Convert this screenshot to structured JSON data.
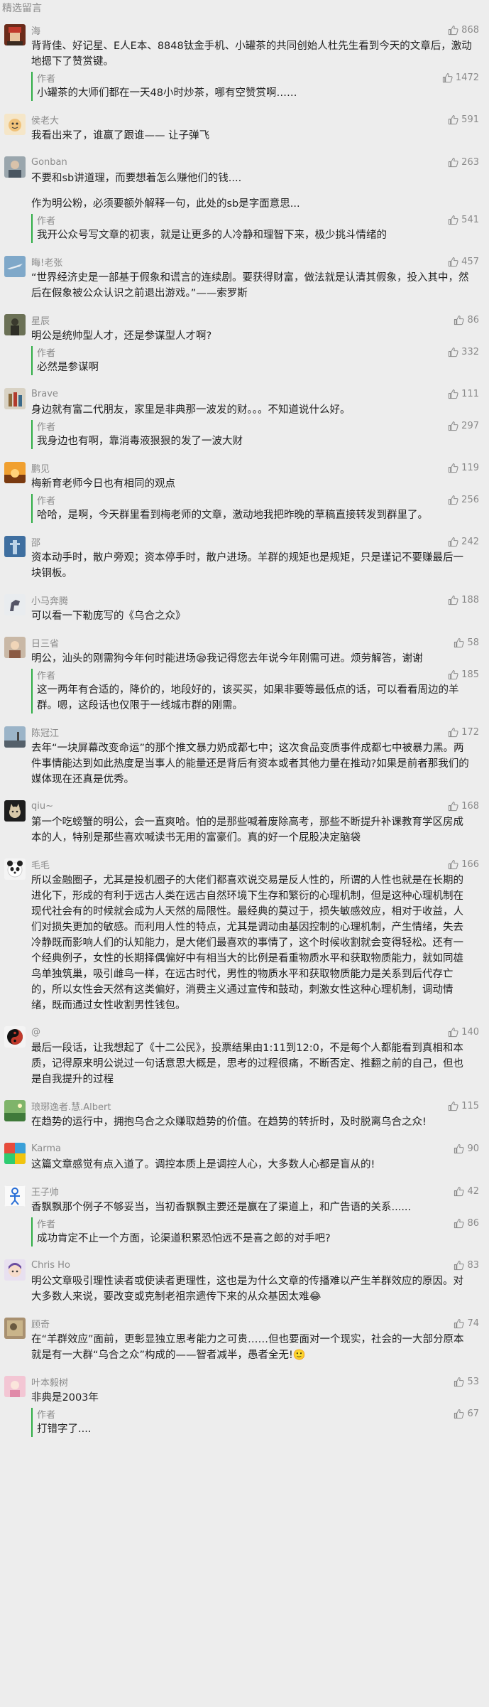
{
  "section_title": "精选留言",
  "colors": {
    "accent_green": "#2fae46",
    "meta_gray": "#8a8a8a",
    "background": "#ededed"
  },
  "comments": [
    {
      "nick": "海",
      "likes": "868",
      "avatar": "avatar-red-cap",
      "paras": [
        "背背佳、好记星、E人E本、8848钛金手机、小罐茶的共同创始人杜先生看到今天的文章后，激动地摁下了赞赏键。"
      ],
      "reply": {
        "label": "作者",
        "likes": "1472",
        "text": "小罐茶的大师们都在一天48小时炒茶，哪有空赞赏啊……"
      }
    },
    {
      "nick": "侯老大",
      "likes": "591",
      "avatar": "avatar-cartoon",
      "paras": [
        "我看出来了，谁赢了跟谁—— 让子弹飞"
      ],
      "reply": null
    },
    {
      "nick": "Gonban",
      "likes": "263",
      "avatar": "avatar-photo",
      "paras": [
        "不要和sb讲道理，而要想着怎么赚他们的钱....",
        "作为明公粉，必须要额外解释一句，此处的sb是字面意思..."
      ],
      "reply": {
        "label": "作者",
        "likes": "541",
        "text": "我开公众号写文章的初衷，就是让更多的人冷静和理智下来，极少挑斗情绪的"
      }
    },
    {
      "nick": "晦!老张",
      "likes": "457",
      "avatar": "avatar-blue-plane",
      "paras": [
        "“世界经济史是一部基于假象和谎言的连续剧。要获得财富，做法就是认清其假象，投入其中，然后在假象被公众认识之前退出游戏。”——索罗斯"
      ],
      "reply": null
    },
    {
      "nick": "星辰",
      "likes": "86",
      "avatar": "avatar-dark-figure",
      "paras": [
        "明公是统帅型人才，还是参谋型人才啊?"
      ],
      "reply": {
        "label": "作者",
        "likes": "332",
        "text": "必然是参谋啊"
      }
    },
    {
      "nick": "Brave",
      "likes": "111",
      "avatar": "avatar-bottles",
      "paras": [
        "身边就有富二代朋友，家里是非典那一波发的财。。。不知道说什么好。"
      ],
      "reply": {
        "label": "作者",
        "likes": "297",
        "text": "我身边也有啊，靠消毒液狠狠的发了一波大财"
      }
    },
    {
      "nick": "鹏见",
      "likes": "119",
      "avatar": "avatar-sunset",
      "paras": [
        "梅新育老师今日也有相同的观点"
      ],
      "reply": {
        "label": "作者",
        "likes": "256",
        "text": "哈哈，是啊，今天群里看到梅老师的文章，激动地我把昨晚的草稿直接转发到群里了。"
      }
    },
    {
      "nick": "邵",
      "likes": "242",
      "avatar": "avatar-blue-figure",
      "paras": [
        "资本动手时，散户旁观；资本停手时，散户进场。羊群的规矩也是规矩，只是谨记不要赚最后一块铜板。"
      ],
      "reply": null
    },
    {
      "nick": "小马奔腾",
      "likes": "188",
      "avatar": "avatar-horse",
      "paras": [
        "可以看一下勒庞写的《乌合之众》"
      ],
      "reply": null
    },
    {
      "nick": "日三省",
      "likes": "58",
      "avatar": "avatar-person",
      "paras": [
        "明公，汕头的刚需狗今年何时能进场😪我记得您去年说今年刚需可进。烦劳解答，谢谢"
      ],
      "reply": {
        "label": "作者",
        "likes": "185",
        "text": "这一两年有合适的，降价的，地段好的，该买买，如果非要等最低点的话，可以看看周边的羊群。嗯，这段话也仅限于一线城市群的刚需。"
      }
    },
    {
      "nick": "陈冠江",
      "likes": "172",
      "avatar": "avatar-sky",
      "paras": [
        "去年“一块屏幕改变命运”的那个推文暴力奶成都七中；这次食品变质事件成都七中被暴力黑。两件事情能达到如此热度是当事人的能量还是背后有资本或者其他力量在推动?如果是前者那我们的媒体现在还真是优秀。"
      ],
      "reply": null
    },
    {
      "nick": "qiu~",
      "likes": "168",
      "avatar": "avatar-cat",
      "paras": [
        "第一个吃螃蟹的明公，会一直爽哈。怕的是那些喊着废除高考，那些不断提升补课教育学区房成本的人，特别是那些喜欢喊读书无用的富豪们。真的好一个屁股决定脑袋"
      ],
      "reply": null
    },
    {
      "nick": "毛毛",
      "likes": "166",
      "avatar": "avatar-panda",
      "paras": [
        "所以金融圈子，尤其是投机圈子的大佬们都喜欢说交易是反人性的，所谓的人性也就是在长期的进化下，形成的有利于远古人类在远古自然环境下生存和繁衍的心理机制，但是这种心理机制在现代社会有的时候就会成为人天然的局限性。最经典的莫过于，损失敏感效应，相对于收益，人们对损失更加的敏感。而利用人性的特点，尤其是调动由基因控制的心理机制，产生情绪，失去冷静既而影响人们的认知能力，是大佬们最喜欢的事情了，这个时候收割就会变得轻松。还有一个经典例子，女性的长期择偶偏好中有相当大的比例是看重物质水平和获取物质能力，就如同雄鸟单独筑巢，吸引雌鸟一样，在远古时代，男性的物质水平和获取物质能力是关系到后代存亡的，所以女性会天然有这类偏好，消费主义通过宣传和鼓动，刺激女性这种心理机制，调动情绪，既而通过女性收割男性钱包。"
      ],
      "reply": null
    },
    {
      "nick": "@",
      "likes": "140",
      "avatar": "avatar-yinyang",
      "paras": [
        "最后一段话，让我想起了《十二公民》，投票结果由1:11到12:0，不是每个人都能看到真相和本质，记得原来明公说过一句话意思大概是，思考的过程很痛，不断否定、推翻之前的自己，但也是自我提升的过程"
      ],
      "reply": null
    },
    {
      "nick": "琅琊逸者.慧.Albert",
      "likes": "115",
      "avatar": "avatar-green-landscape",
      "paras": [
        "在趋势的运行中，拥抱乌合之众赚取趋势的价值。在趋势的转折时，及时脱离乌合之众!"
      ],
      "reply": null
    },
    {
      "nick": "Karma",
      "likes": "90",
      "avatar": "avatar-colorful",
      "paras": [
        "这篇文章感觉有点入道了。调控本质上是调控人心，大多数人心都是盲从的!"
      ],
      "reply": null
    },
    {
      "nick": "王子帅",
      "likes": "42",
      "avatar": "avatar-stick-figure",
      "paras": [
        "香飘飘那个例子不够妥当，当初香飘飘主要还是赢在了渠道上，和广告语的关系......"
      ],
      "reply": {
        "label": "作者",
        "likes": "86",
        "text": "成功肯定不止一个方面，论渠道积累恐怕远不是喜之郎的对手吧?"
      }
    },
    {
      "nick": "Chris Ho",
      "likes": "83",
      "avatar": "avatar-anime",
      "paras": [
        "明公文章吸引理性读者或使读者更理性，这也是为什么文章的传播难以产生羊群效应的原因。对大多数人来说，要改变或克制老祖宗遗传下来的从众基因太难😂"
      ],
      "reply": null
    },
    {
      "nick": "顾奇",
      "likes": "74",
      "avatar": "avatar-painting",
      "paras": [
        "在“羊群效应”面前，更彰显独立思考能力之可贵……但也要面对一个现实，社会的一大部分原本就是有一大群“乌合之众”构成的——智者减半，愚者全无!🙂"
      ],
      "reply": null
    },
    {
      "nick": "叶本毅树",
      "likes": "53",
      "avatar": "avatar-pink",
      "paras": [
        "非典是2003年"
      ],
      "reply": {
        "label": "作者",
        "likes": "67",
        "text": "打错字了...."
      }
    }
  ]
}
